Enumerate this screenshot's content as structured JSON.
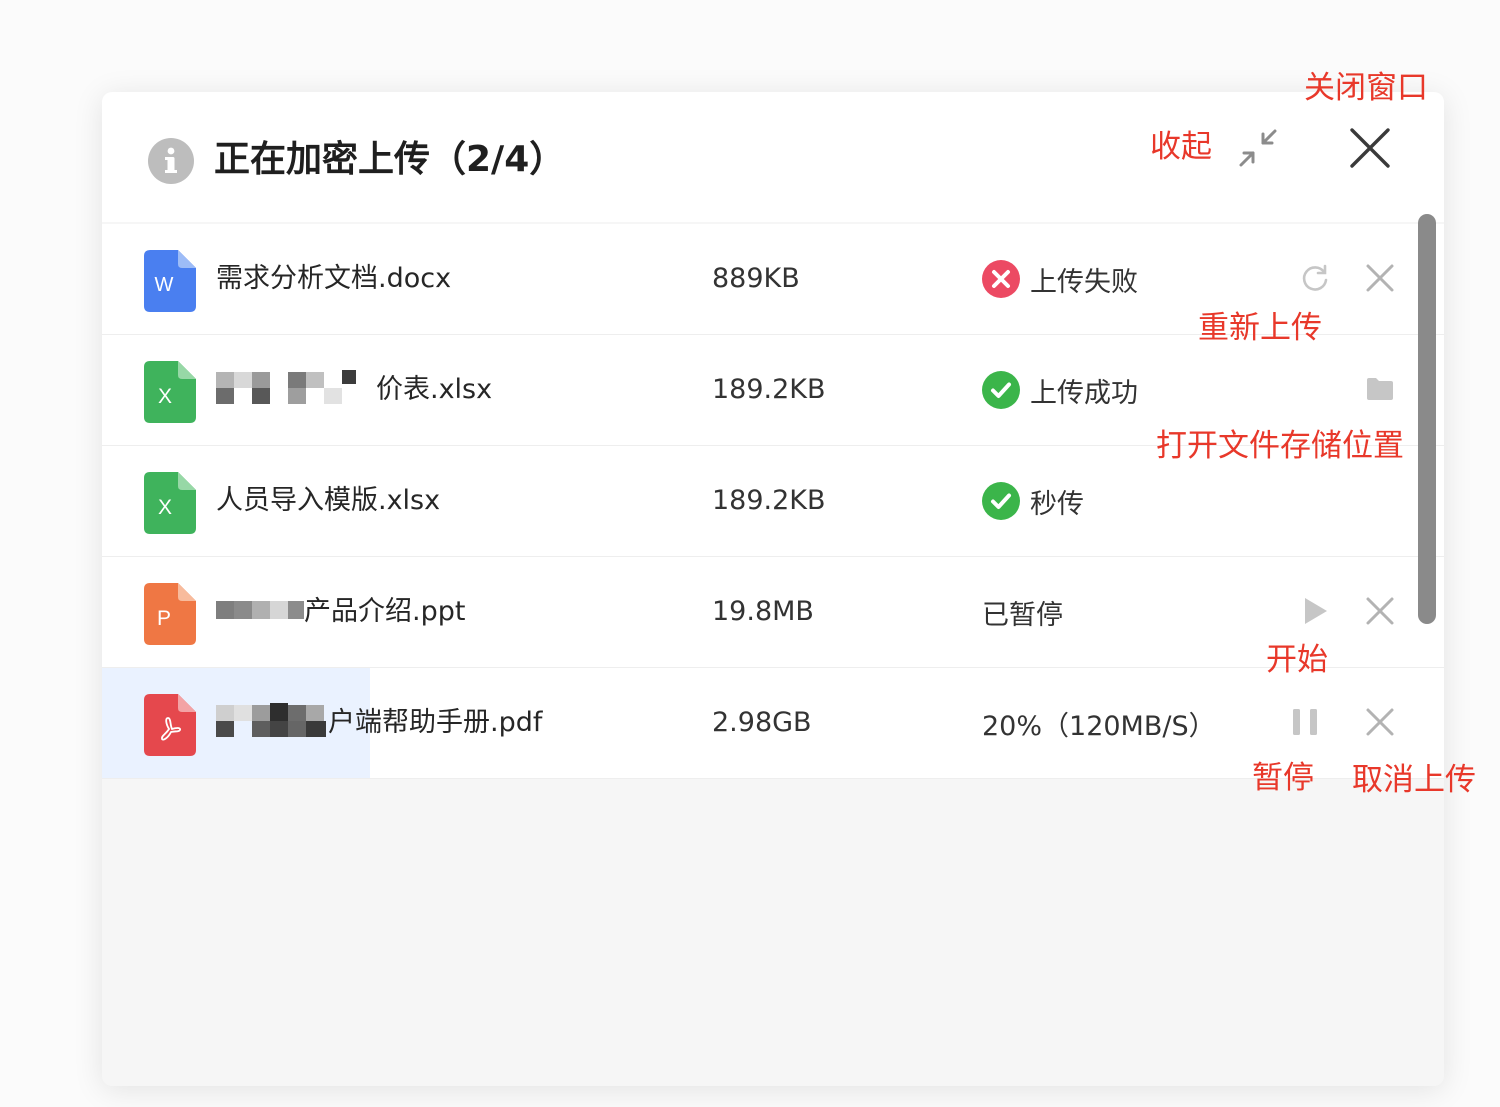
{
  "header": {
    "title": "正在加密上传（2/4）"
  },
  "files": [
    {
      "type": "word",
      "icon_letter": "W",
      "name": "需求分析文档.docx",
      "size": "889KB",
      "status": "上传失败"
    },
    {
      "type": "excel",
      "icon_letter": "X",
      "name": "价表.xlsx",
      "size": "189.2KB",
      "status": "上传成功"
    },
    {
      "type": "excel",
      "icon_letter": "X",
      "name": "人员导入模版.xlsx",
      "size": "189.2KB",
      "status": "秒传"
    },
    {
      "type": "ppt",
      "icon_letter": "P",
      "name": "产品介绍.ppt",
      "size": "19.8MB",
      "status": "已暂停"
    },
    {
      "type": "pdf",
      "icon_letter": "",
      "name": "户端帮助手册.pdf",
      "size": "2.98GB",
      "status": "20%（120MB/S）",
      "progress": 0.2
    }
  ],
  "annotations": {
    "close_window": "关闭窗口",
    "collapse": "收起",
    "reupload": "重新上传",
    "open_location": "打开文件存储位置",
    "start": "开始",
    "pause": "暂停",
    "cancel_upload": "取消上传"
  },
  "colors": {
    "annotation": "#e8382a",
    "word": "#4a7ff0",
    "excel": "#3fb35c",
    "ppt": "#ef7744",
    "pdf": "#e5484d",
    "error": "#ec4a63",
    "success": "#3bb54a",
    "progress": "#eaf2ff"
  },
  "icons": {
    "header": "info-icon",
    "collapse": "collapse-icon",
    "close": "close-icon",
    "retry": "refresh-icon",
    "cancel": "x-icon",
    "folder": "folder-icon",
    "play": "play-icon",
    "pause": "pause-icon"
  }
}
